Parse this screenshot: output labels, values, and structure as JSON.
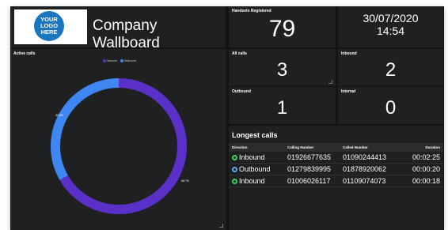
{
  "header": {
    "logo_text": "YOUR LOGO HERE",
    "company": "Company Wallboard"
  },
  "tiles": {
    "handsets": {
      "label": "Handsets Registered",
      "value": "79"
    },
    "date": "30/07/2020",
    "time": "14:54",
    "all_calls": {
      "label": "All calls",
      "value": "3"
    },
    "inbound": {
      "label": "Inbound",
      "value": "2"
    },
    "outbound": {
      "label": "Outbound",
      "value": "1"
    },
    "internal": {
      "label": "Internal",
      "value": "0"
    }
  },
  "chart_panel_title": "Active calls",
  "chart_data": {
    "type": "pie",
    "donut": true,
    "categories": [
      "Inbound",
      "Outbound"
    ],
    "values": [
      66.7,
      33.3
    ],
    "slice_labels": [
      "66.7%",
      "33.3%"
    ],
    "colors": [
      "#5b30c8",
      "#3e87f3"
    ],
    "legend": "top"
  },
  "longest_calls": {
    "title": "Longest calls",
    "columns": [
      "Direction",
      "Calling Number",
      "Called Number",
      "Duration"
    ],
    "rows": [
      {
        "direction": "Inbound",
        "calling": "01926677635",
        "called": "01090244413",
        "duration": "00:02:25",
        "icon_color": "#3ecf5a"
      },
      {
        "direction": "Outbound",
        "calling": "01279839995",
        "called": "01878920062",
        "duration": "00:00:20",
        "icon_color": "#5aa8f0"
      },
      {
        "direction": "Inbound",
        "calling": "01006026117",
        "called": "01109074073",
        "duration": "00:00:18",
        "icon_color": "#3ecf5a"
      }
    ]
  }
}
